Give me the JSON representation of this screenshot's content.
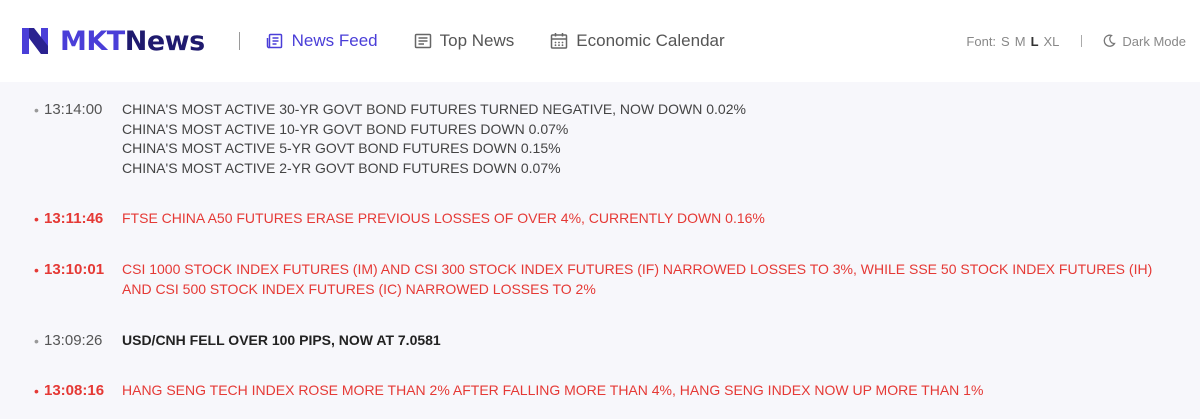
{
  "header": {
    "logo_mkt": "MKT",
    "logo_news": "News",
    "nav": [
      {
        "label": "News Feed",
        "icon": "news-feed-icon",
        "active": true
      },
      {
        "label": "Top News",
        "icon": "top-news-icon",
        "active": false
      },
      {
        "label": "Economic Calendar",
        "icon": "calendar-icon",
        "active": false
      }
    ],
    "font_label": "Font:",
    "font_sizes": [
      "S",
      "M",
      "L",
      "XL"
    ],
    "font_active": "L",
    "dark_mode_label": "Dark Mode"
  },
  "colors": {
    "brand": "#4a3ed8",
    "brand_dark": "#1f1a6e",
    "alert": "#e53935"
  },
  "feed": [
    {
      "time": "13:14:00",
      "style": "normal",
      "lines": [
        "CHINA'S MOST ACTIVE 30-YR GOVT BOND FUTURES TURNED NEGATIVE, NOW DOWN 0.02%",
        "CHINA'S MOST ACTIVE 10-YR GOVT BOND FUTURES DOWN 0.07%",
        "CHINA'S MOST ACTIVE 5-YR GOVT BOND FUTURES DOWN 0.15%",
        "CHINA'S MOST ACTIVE 2-YR GOVT BOND FUTURES DOWN 0.07%"
      ]
    },
    {
      "time": "13:11:46",
      "style": "red",
      "lines": [
        "FTSE CHINA A50 FUTURES ERASE PREVIOUS LOSSES OF OVER 4%, CURRENTLY DOWN 0.16%"
      ]
    },
    {
      "time": "13:10:01",
      "style": "red",
      "lines": [
        "CSI 1000 STOCK INDEX FUTURES (IM) AND CSI 300 STOCK INDEX FUTURES (IF) NARROWED LOSSES TO 3%, WHILE SSE 50 STOCK INDEX FUTURES (IH) AND CSI 500 STOCK INDEX FUTURES (IC) NARROWED LOSSES TO 2%"
      ]
    },
    {
      "time": "13:09:26",
      "style": "bold",
      "lines": [
        "USD/CNH FELL OVER 100 PIPS, NOW AT 7.0581"
      ]
    },
    {
      "time": "13:08:16",
      "style": "red",
      "lines": [
        "HANG SENG TECH INDEX ROSE MORE THAN 2% AFTER FALLING MORE THAN 4%, HANG SENG INDEX NOW UP MORE THAN 1%"
      ]
    }
  ]
}
